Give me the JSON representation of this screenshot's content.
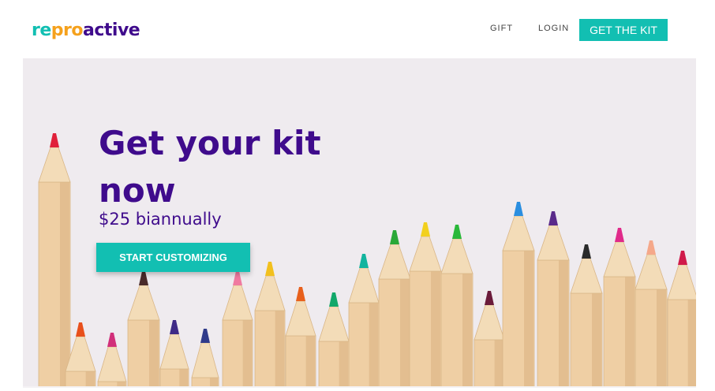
{
  "header": {
    "logo": {
      "parts": [
        {
          "text": "re",
          "color": "#12bfb2"
        },
        {
          "text": "pro",
          "color": "#f5a11c"
        },
        {
          "text": "active",
          "color": "#3f0b8c"
        }
      ]
    },
    "nav": {
      "gift_label": "GIFT",
      "login_label": "LOGIN",
      "cta_label": "GET THE KIT"
    }
  },
  "hero": {
    "title": "Get your kit now",
    "price": "$25 biannually",
    "cta_label": "START CUSTOMIZING",
    "background_image": "colored-pencils"
  },
  "colors": {
    "accent": "#12bfb2",
    "brand_purple": "#3f0b8c",
    "hero_bg": "#efebef"
  }
}
